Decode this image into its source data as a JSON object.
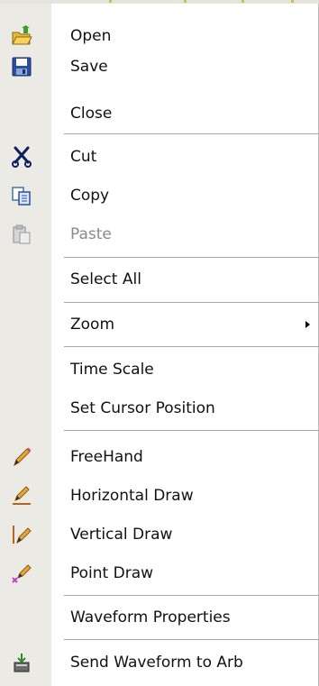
{
  "menu": {
    "items": [
      {
        "label": "Open",
        "icon": "open-folder-icon",
        "enabled": true
      },
      {
        "label": "Save",
        "icon": "save-disk-icon",
        "enabled": true
      },
      {
        "label": "Close",
        "icon": "",
        "enabled": true
      },
      {
        "label": "Cut",
        "icon": "scissors-icon",
        "enabled": true
      },
      {
        "label": "Copy",
        "icon": "copy-icon",
        "enabled": true
      },
      {
        "label": "Paste",
        "icon": "paste-icon",
        "enabled": false
      },
      {
        "label": "Select All",
        "icon": "",
        "enabled": true
      },
      {
        "label": "Zoom",
        "icon": "",
        "enabled": true,
        "submenu": true
      },
      {
        "label": "Time Scale",
        "icon": "",
        "enabled": true
      },
      {
        "label": "Set Cursor Position",
        "icon": "",
        "enabled": true
      },
      {
        "label": "FreeHand",
        "icon": "pencil-freehand-icon",
        "enabled": true
      },
      {
        "label": "Horizontal Draw",
        "icon": "pencil-horizontal-icon",
        "enabled": true
      },
      {
        "label": "Vertical Draw",
        "icon": "pencil-vertical-icon",
        "enabled": true
      },
      {
        "label": "Point Draw",
        "icon": "pencil-point-icon",
        "enabled": true
      },
      {
        "label": "Waveform Properties",
        "icon": "",
        "enabled": true
      },
      {
        "label": "Send Waveform to Arb",
        "icon": "send-to-arb-icon",
        "enabled": true
      }
    ]
  },
  "colors": {
    "gutter": "#eceae4",
    "separator": "#a8a8a8",
    "text": "#111111",
    "disabled_text": "#8a8a8a"
  }
}
